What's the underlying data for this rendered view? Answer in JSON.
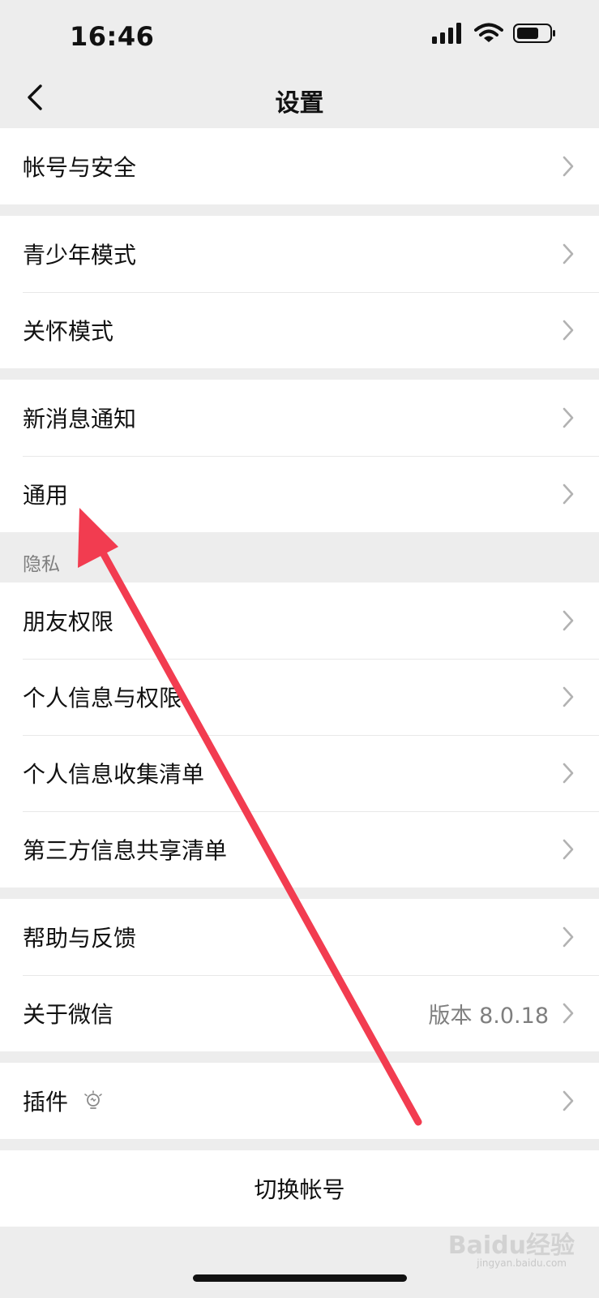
{
  "status_bar": {
    "time": "16:46",
    "icons": [
      "signal-icon",
      "wifi-icon",
      "battery-icon"
    ]
  },
  "nav": {
    "title": "设置",
    "back_icon": "chevron-left-icon"
  },
  "groups": [
    {
      "items": [
        {
          "label": "帐号与安全"
        }
      ]
    },
    {
      "items": [
        {
          "label": "青少年模式"
        },
        {
          "label": "关怀模式"
        }
      ]
    },
    {
      "items": [
        {
          "label": "新消息通知"
        },
        {
          "label": "通用"
        }
      ]
    }
  ],
  "privacy": {
    "section_title": "隐私",
    "items": [
      {
        "label": "朋友权限"
      },
      {
        "label": "个人信息与权限"
      },
      {
        "label": "个人信息收集清单"
      },
      {
        "label": "第三方信息共享清单"
      }
    ]
  },
  "support": {
    "items": [
      {
        "label": "帮助与反馈"
      },
      {
        "label": "关于微信",
        "value": "版本 8.0.18"
      }
    ]
  },
  "plugins": {
    "label": "插件",
    "icon": "lightbulb-icon"
  },
  "actions": {
    "switch_account": "切换帐号"
  },
  "watermark": {
    "text": "Baidu经验",
    "sub": "jingyan.baidu.com"
  },
  "annotation": {
    "color": "#f23c50",
    "icon": "red-arrow-annotation"
  }
}
